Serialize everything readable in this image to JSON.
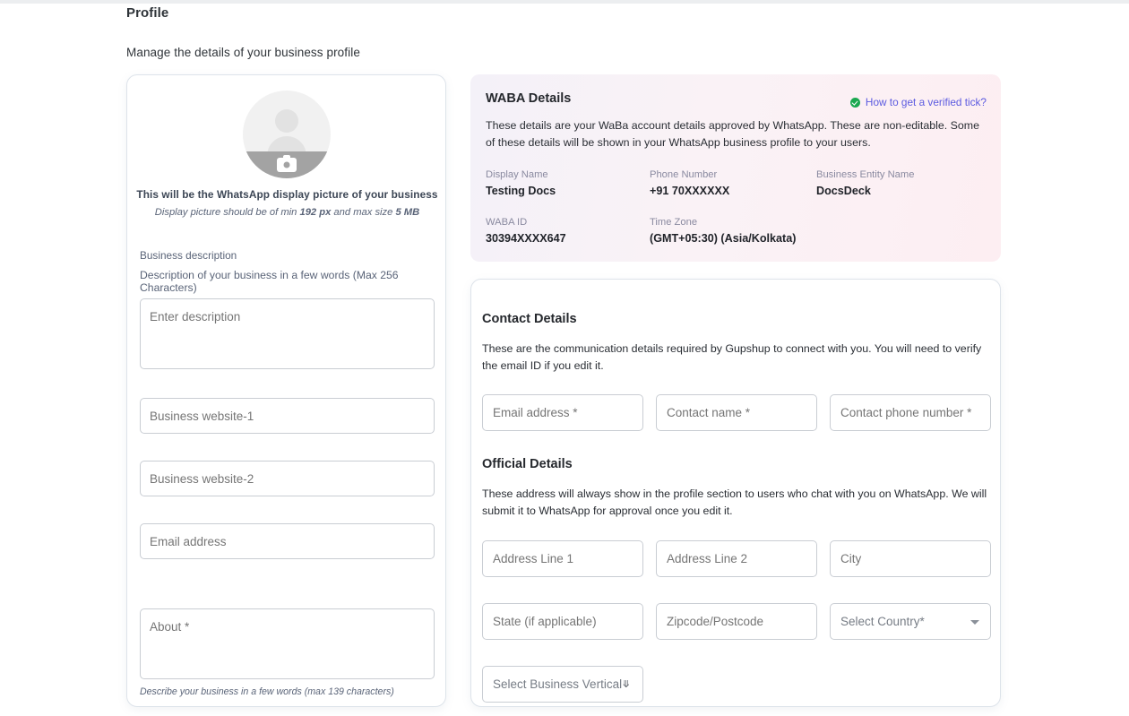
{
  "header": {
    "title": "Profile",
    "subtitle": "Manage the details of your business profile"
  },
  "profile_card": {
    "avatar_icon": "person-avatar-icon",
    "camera_icon": "camera-icon",
    "caption": "This will be the WhatsApp display picture of your business",
    "hint_prefix": "Display picture should be of min ",
    "hint_min": "192 px",
    "hint_mid": " and max size ",
    "hint_max": "5 MB",
    "business_description_label": "Business description",
    "business_description_sublabel": "Description of your business in a few words (Max 256 Characters)",
    "fields": {
      "description_placeholder": "Enter description",
      "description_value": "",
      "website1_placeholder": "Business website-1",
      "website1_value": "",
      "website2_placeholder": "Business website-2",
      "website2_value": "",
      "email_placeholder": "Email address",
      "email_value": "",
      "about_placeholder": "About *",
      "about_value": ""
    },
    "about_hint": "Describe your business in a few words (max 139 characters)"
  },
  "waba": {
    "title": "WABA Details",
    "verified_link": "How to get a verified tick?",
    "verified_icon": "green-check-badge-icon",
    "description": "These details are your WaBa account details approved by WhatsApp. These are non-editable. Some of these details will be shown in your WhatsApp business profile to your users.",
    "fields": [
      {
        "label": "Display Name",
        "value": "Testing Docs"
      },
      {
        "label": "Phone Number",
        "value": "+91 70XXXXXX"
      },
      {
        "label": "Business Entity Name",
        "value": "DocsDeck"
      },
      {
        "label": "WABA ID",
        "value": "30394XXXX647"
      },
      {
        "label": "Time Zone",
        "value": "(GMT+05:30) (Asia/Kolkata)"
      }
    ],
    "accent_link_color": "#5b5ae0",
    "accent_tick_color": "#1aa84f"
  },
  "contact_details": {
    "title": "Contact Details",
    "description": "These are the communication details required by Gupshup to connect with you. You will need to verify the email ID if you edit it.",
    "fields": {
      "email_placeholder": "Email address *",
      "email_value": "",
      "name_placeholder": "Contact name *",
      "name_value": "",
      "phone_placeholder": "Contact phone number *",
      "phone_value": ""
    }
  },
  "official_details": {
    "title": "Official Details",
    "description": "These address will always show in the profile section to users who chat with you on WhatsApp. We will submit it to WhatsApp for approval once you edit it.",
    "fields": {
      "address1_placeholder": "Address Line 1",
      "address1_value": "",
      "address2_placeholder": "Address Line 2",
      "address2_value": "",
      "city_placeholder": "City",
      "city_value": "",
      "state_placeholder": "State (if applicable)",
      "state_value": "",
      "zipcode_placeholder": "Zipcode/Postcode",
      "zipcode_value": "",
      "country_selected": "Select Country*",
      "business_vertical_selected": "Select Business Vertical"
    }
  }
}
